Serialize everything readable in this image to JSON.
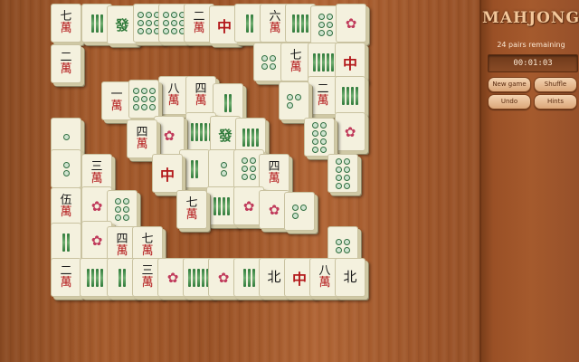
{
  "game": {
    "title": "MAHJONG",
    "pairs_remaining": "24 pairs remaining",
    "timer": "00:01:03"
  },
  "buttons": {
    "new_game": "New game",
    "shuffle": "Shuffle",
    "undo": "Undo",
    "hints": "Hints"
  },
  "tiles": [
    {
      "kind": "char",
      "top": "七"
    },
    {
      "kind": "bam",
      "n": 3
    },
    {
      "kind": "green",
      "text": "發"
    },
    {
      "kind": "dots",
      "n": 9
    },
    {
      "kind": "dots",
      "n": 9
    },
    {
      "kind": "char",
      "top": "二"
    },
    {
      "kind": "red",
      "text": "中"
    },
    {
      "kind": "bam",
      "n": 2
    },
    {
      "kind": "char",
      "top": "六"
    },
    {
      "kind": "bam",
      "n": 4
    },
    {
      "kind": "dots",
      "n": 6
    },
    {
      "kind": "flower"
    },
    {
      "kind": "char",
      "top": "二"
    },
    {
      "kind": "dots",
      "n": 4
    },
    {
      "kind": "char",
      "top": "七"
    },
    {
      "kind": "bam",
      "n": 6
    },
    {
      "kind": "red",
      "text": "中"
    },
    {
      "kind": "char",
      "top": "一"
    },
    {
      "kind": "dots",
      "n": 9
    },
    {
      "kind": "char",
      "top": "八"
    },
    {
      "kind": "char",
      "top": "四"
    },
    {
      "kind": "bam",
      "n": 2
    },
    {
      "kind": "dots",
      "n": 3
    },
    {
      "kind": "char",
      "top": "二"
    },
    {
      "kind": "bam",
      "n": 4
    },
    {
      "kind": "dots",
      "n": 1
    },
    {
      "kind": "char",
      "top": "四"
    },
    {
      "kind": "flower"
    },
    {
      "kind": "bam",
      "n": 6
    },
    {
      "kind": "green",
      "text": "發"
    },
    {
      "kind": "bam",
      "n": 4
    },
    {
      "kind": "dots",
      "n": 8
    },
    {
      "kind": "flower"
    },
    {
      "kind": "dots",
      "n": 2
    },
    {
      "kind": "char",
      "top": "三"
    },
    {
      "kind": "red",
      "text": "中"
    },
    {
      "kind": "bam",
      "n": 2
    },
    {
      "kind": "dots",
      "n": 2
    },
    {
      "kind": "dots",
      "n": 6
    },
    {
      "kind": "char",
      "top": "四"
    },
    {
      "kind": "dots",
      "n": 8
    },
    {
      "kind": "char",
      "top": "伍"
    },
    {
      "kind": "flower"
    },
    {
      "kind": "dots",
      "n": 6
    },
    {
      "kind": "char",
      "top": "七"
    },
    {
      "kind": "bam",
      "n": 4
    },
    {
      "kind": "flower"
    },
    {
      "kind": "flower"
    },
    {
      "kind": "dots",
      "n": 3
    },
    {
      "kind": "bam",
      "n": 2
    },
    {
      "kind": "flower"
    },
    {
      "kind": "char",
      "top": "四"
    },
    {
      "kind": "char",
      "top": "七"
    },
    {
      "kind": "dots",
      "n": 4
    },
    {
      "kind": "char",
      "top": "二"
    },
    {
      "kind": "bam",
      "n": 4
    },
    {
      "kind": "bam",
      "n": 2
    },
    {
      "kind": "char",
      "top": "三"
    },
    {
      "kind": "flower"
    },
    {
      "kind": "bam",
      "n": 9
    },
    {
      "kind": "flower"
    },
    {
      "kind": "bam",
      "n": 3
    },
    {
      "kind": "wind",
      "text": "北"
    },
    {
      "kind": "red",
      "text": "中"
    },
    {
      "kind": "char",
      "top": "八"
    },
    {
      "kind": "wind",
      "text": "北"
    }
  ]
}
